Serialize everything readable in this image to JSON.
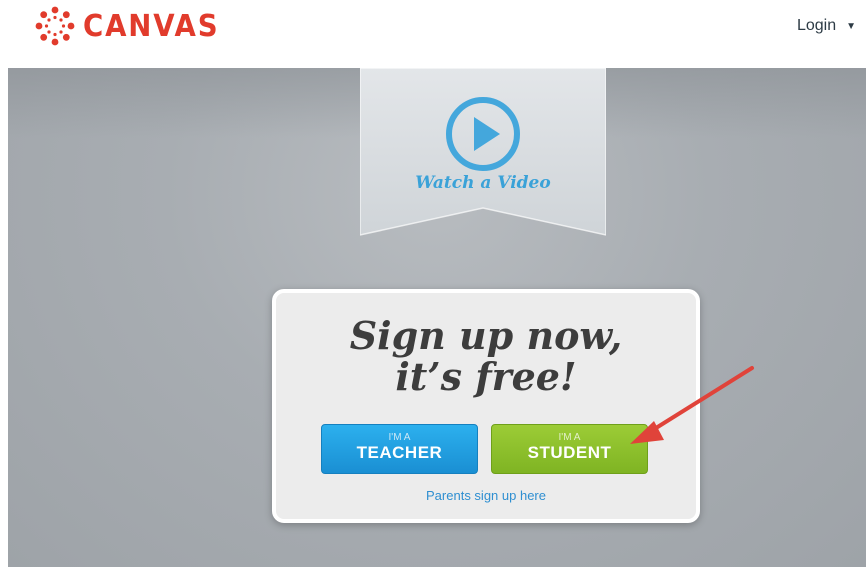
{
  "header": {
    "logo_text": "CANVAS",
    "login_label": "Login",
    "login_caret": "▼"
  },
  "hero": {
    "video_label": "Watch a Video"
  },
  "signup": {
    "headline_line1": "Sign up now,",
    "headline_line2": "it’s free!",
    "teacher_small": "I'M A",
    "teacher_big": "TEACHER",
    "student_small": "I'M A",
    "student_big": "STUDENT",
    "parents_link": "Parents sign up here"
  },
  "colors": {
    "brand_red": "#e13b2c",
    "teacher_blue": "#1a8fd3",
    "student_green": "#7fb423",
    "link_blue": "#2f8fd1",
    "annotation_arrow": "#e0433a"
  },
  "icons": {
    "logo": "canvas-logo-icon",
    "video": "play-circle-icon",
    "annotation": "red-arrow-icon"
  }
}
